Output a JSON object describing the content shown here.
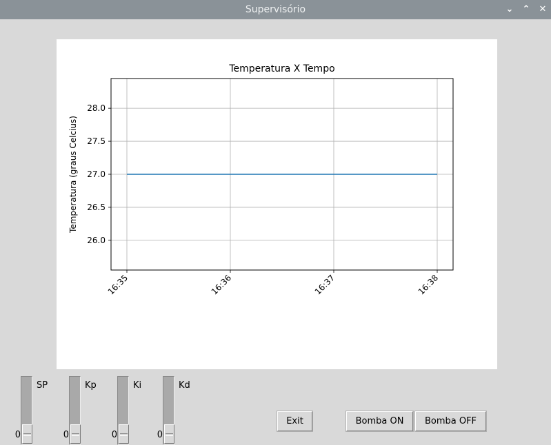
{
  "window": {
    "title": "Supervisório",
    "buttons": [
      "⌄",
      "⌃",
      "✕"
    ]
  },
  "chart_data": {
    "type": "line",
    "title": "Temperatura X Tempo",
    "xlabel": "",
    "ylabel": "Temperatura (graus Celcius)",
    "x": [
      "16:35",
      "16:38"
    ],
    "series": [
      {
        "values": [
          27.0,
          27.0
        ],
        "color": "#1f77b4"
      }
    ],
    "xticks": [
      "16:35",
      "16:36",
      "16:37",
      "16:38"
    ],
    "yticks": [
      "26.0",
      "26.5",
      "27.0",
      "27.5",
      "28.0"
    ],
    "ylim": [
      25.55,
      28.45
    ],
    "grid": true
  },
  "sliders": [
    {
      "label": "SP",
      "value": "0"
    },
    {
      "label": "Kp",
      "value": "0"
    },
    {
      "label": "Ki",
      "value": "0"
    },
    {
      "label": "Kd",
      "value": "0"
    }
  ],
  "buttons": {
    "exit": "Exit",
    "pump_on": "Bomba ON",
    "pump_off": "Bomba OFF"
  }
}
